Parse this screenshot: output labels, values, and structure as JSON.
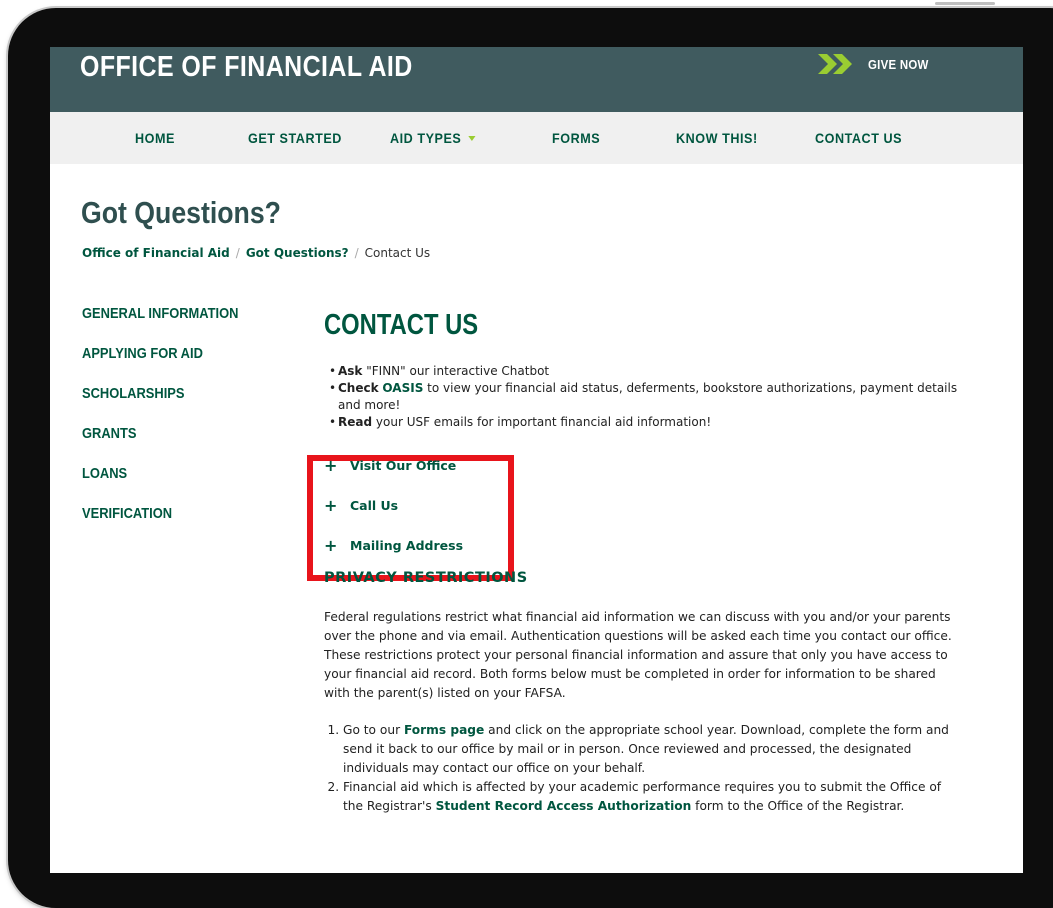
{
  "header": {
    "site_title": "OFFICE OF FINANCIAL AID",
    "give_now": "GIVE NOW",
    "brand_color": "#405b5f",
    "accent_color": "#9acd32"
  },
  "nav": {
    "items": [
      "HOME",
      "GET STARTED",
      "AID TYPES",
      "FORMS",
      "KNOW THIS!",
      "CONTACT US"
    ]
  },
  "page": {
    "title": "Got Questions?",
    "breadcrumb": [
      "Office of Financial Aid",
      "Got Questions?",
      "Contact Us"
    ]
  },
  "sidebar": {
    "items": [
      "GENERAL INFORMATION",
      "APPLYING FOR AID",
      "SCHOLARSHIPS",
      "GRANTS",
      "LOANS",
      "VERIFICATION"
    ]
  },
  "main": {
    "heading": "CONTACT US",
    "bullets": [
      {
        "bold": "Ask",
        "text": " \"FINN\" our interactive Chatbot"
      },
      {
        "bold": "Check",
        "link": "OASIS",
        "text": " to view your financial aid status, deferments, bookstore authorizations, payment details and more!"
      },
      {
        "bold": "Read",
        "text": " your USF emails for important financial aid information!"
      }
    ],
    "accordion": [
      "Visit Our Office",
      "Call Us",
      "Mailing Address"
    ],
    "privacy_heading": "PRIVACY RESTRICTIONS",
    "privacy_text": "Federal regulations restrict what financial aid information we can discuss with you and/or your parents over the phone and via email. Authentication questions will be asked each time you contact our office. These restrictions protect your personal financial information and assure that only you have access to your financial aid record. Both forms below must be completed in order for information to be shared with the parent(s) listed on your FAFSA.",
    "steps": [
      {
        "pre": "Go to our ",
        "link": "Forms page",
        "post": " and click on the appropriate school year. Download, complete the form and send it back to our office by mail or in person. Once reviewed and processed, the designated individuals may contact our office on your behalf."
      },
      {
        "pre": "Financial aid which is affected by your academic performance requires you to submit the Office of the Registrar's ",
        "link": "Student Record Access Authorization",
        "post": " form to the Office of the Registrar."
      }
    ]
  }
}
